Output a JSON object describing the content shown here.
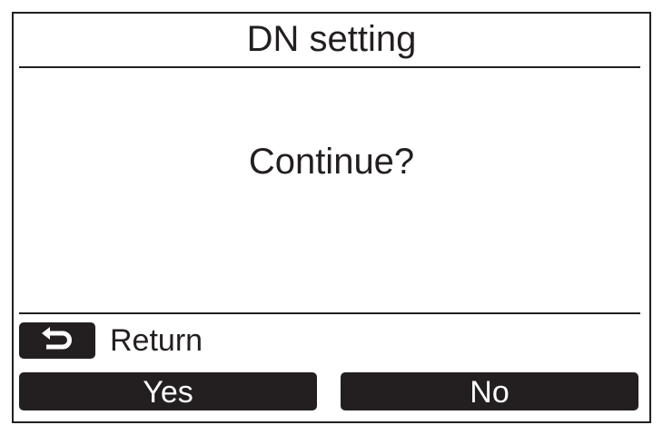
{
  "header": {
    "title": "DN setting"
  },
  "dialog": {
    "message": "Continue?"
  },
  "return_control": {
    "icon": "return-arrow-icon",
    "label": "Return"
  },
  "buttons": {
    "yes_label": "Yes",
    "no_label": "No"
  },
  "colors": {
    "frame": "#231f20",
    "background": "#ffffff",
    "button_text": "#ffffff"
  }
}
